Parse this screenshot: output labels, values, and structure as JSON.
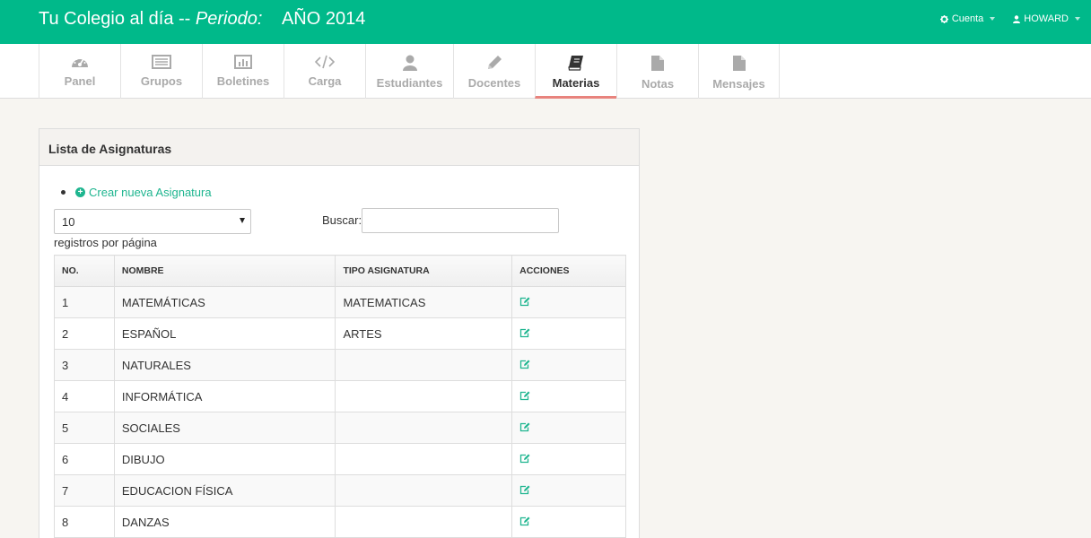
{
  "header": {
    "brand": "Tu Colegio al día --",
    "periodo_label": "Periodo:",
    "periodo_value": "AÑO 2014",
    "account_label": "Cuenta",
    "user_label": "HOWARD"
  },
  "nav": {
    "items": [
      {
        "label": "Panel",
        "icon": "dashboard-icon"
      },
      {
        "label": "Grupos",
        "icon": "list-icon"
      },
      {
        "label": "Boletines",
        "icon": "bar-chart-icon"
      },
      {
        "label": "Carga",
        "icon": "code-icon"
      },
      {
        "label": "Estudiantes",
        "icon": "user-icon"
      },
      {
        "label": "Docentes",
        "icon": "pencil-icon"
      },
      {
        "label": "Materias",
        "icon": "book-icon",
        "active": true
      },
      {
        "label": "Notas",
        "icon": "file-icon"
      },
      {
        "label": "Mensajes",
        "icon": "file-icon"
      }
    ]
  },
  "panel": {
    "title": "Lista de Asignaturas",
    "create_link": "Crear nueva Asignatura",
    "length_value": "10",
    "length_label": "registros por página",
    "search_label": "Buscar:",
    "search_value": ""
  },
  "table": {
    "columns": [
      "NO.",
      "NOMBRE",
      "TIPO ASIGNATURA",
      "ACCIONES"
    ],
    "rows": [
      {
        "no": "1",
        "nombre": "MATEMÁTICAS",
        "tipo": "MATEMATICAS"
      },
      {
        "no": "2",
        "nombre": "ESPAÑOL",
        "tipo": "ARTES"
      },
      {
        "no": "3",
        "nombre": "NATURALES",
        "tipo": ""
      },
      {
        "no": "4",
        "nombre": "INFORMÁTICA",
        "tipo": ""
      },
      {
        "no": "5",
        "nombre": "SOCIALES",
        "tipo": ""
      },
      {
        "no": "6",
        "nombre": "DIBUJO",
        "tipo": ""
      },
      {
        "no": "7",
        "nombre": "EDUCACION FÍSICA",
        "tipo": ""
      },
      {
        "no": "8",
        "nombre": "DANZAS",
        "tipo": ""
      }
    ]
  },
  "colors": {
    "brand": "#00b98a",
    "accent": "#1eb58f",
    "active_underline": "#e8837d"
  }
}
